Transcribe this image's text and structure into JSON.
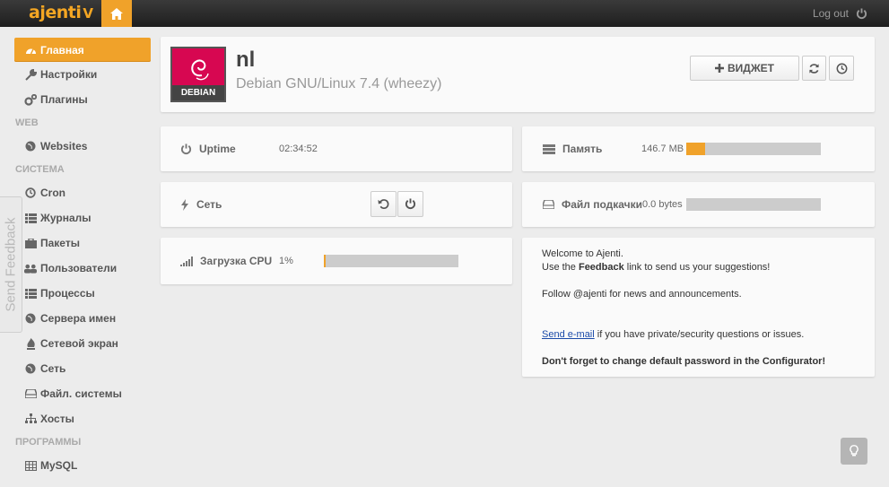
{
  "app": {
    "logo": "ajenti",
    "logo_suffix": "V",
    "logout_label": "Log out"
  },
  "sidebar": {
    "items": [
      {
        "label": "Главная",
        "icon": "dashboard-icon",
        "active": true
      },
      {
        "label": "Настройки",
        "icon": "wrench-icon"
      },
      {
        "label": "Плагины",
        "icon": "cogs-icon"
      }
    ],
    "sections": [
      {
        "title": "WEB",
        "items": [
          {
            "label": "Websites",
            "icon": "globe-icon"
          }
        ]
      },
      {
        "title": "СИСТЕМА",
        "items": [
          {
            "label": "Cron",
            "icon": "clock-icon"
          },
          {
            "label": "Журналы",
            "icon": "list-icon"
          },
          {
            "label": "Пакеты",
            "icon": "briefcase-icon"
          },
          {
            "label": "Пользователи",
            "icon": "users-icon"
          },
          {
            "label": "Процессы",
            "icon": "list-icon"
          },
          {
            "label": "Сервера имен",
            "icon": "globe-icon"
          },
          {
            "label": "Сетевой экран",
            "icon": "fire-icon"
          },
          {
            "label": "Сеть",
            "icon": "globe-icon"
          },
          {
            "label": "Файл. системы",
            "icon": "hdd-icon"
          },
          {
            "label": "Хосты",
            "icon": "sitemap-icon"
          }
        ]
      },
      {
        "title": "ПРОГРАММЫ",
        "items": [
          {
            "label": "MySQL",
            "icon": "table-icon"
          }
        ]
      }
    ]
  },
  "feedback_tab": "Send Feedback",
  "header": {
    "hostname": "nl",
    "os": "Debian GNU/Linux 7.4 (wheezy)",
    "distro_badge": "DEBIAN",
    "widget_button": "ВИДЖЕТ"
  },
  "widgets": {
    "uptime": {
      "label": "Uptime",
      "value": "02:34:52"
    },
    "network": {
      "label": "Сеть"
    },
    "cpu": {
      "label": "Загрузка CPU",
      "value": "1%",
      "fraction": 0.01
    },
    "memory": {
      "label": "Память",
      "value": "146.7 MB",
      "fraction": 0.14
    },
    "swap": {
      "label": "Файл подкачки",
      "value": "0.0 bytes",
      "fraction": 0.0
    }
  },
  "welcome": {
    "line1": "Welcome to Ajenti.",
    "line2_pre": "Use the ",
    "line2_bold": "Feedback",
    "line2_post": " link to send us your suggestions!",
    "line3": "Follow @ajenti for news and announcements.",
    "email_link": "Send e-mail",
    "email_post": " if you have private/security questions or issues.",
    "warning": "Don't forget to change default password in the Configurator!"
  },
  "colors": {
    "accent": "#f0a22a",
    "topbar": "#2a2a2a",
    "debian": "#d70751"
  }
}
